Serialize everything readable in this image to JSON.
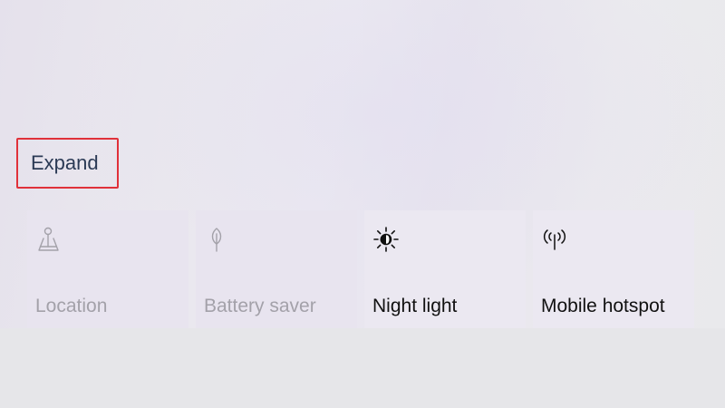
{
  "expand": {
    "label": "Expand",
    "highlight_color": "#e0313a"
  },
  "quick_actions": [
    {
      "label": "Location",
      "icon": "location-icon",
      "enabled": false
    },
    {
      "label": "Battery saver",
      "icon": "battery-saver-icon",
      "enabled": false
    },
    {
      "label": "Night light",
      "icon": "night-light-icon",
      "enabled": true
    },
    {
      "label": "Mobile hotspot",
      "icon": "mobile-hotspot-icon",
      "enabled": true
    }
  ],
  "colors": {
    "text_enabled": "#111111",
    "text_disabled": "#a3a1a9",
    "link_text": "#2b3a55"
  }
}
